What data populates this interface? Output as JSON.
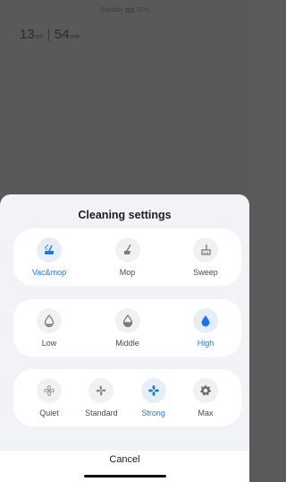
{
  "status": {
    "text": "Standby",
    "battery": "62%"
  },
  "stats": {
    "area_value": "13",
    "area_unit": "m²",
    "time_value": "54",
    "time_unit": "min"
  },
  "sheet": {
    "title": "Cleaning settings",
    "mode": {
      "options": [
        {
          "label": "Vac&mop",
          "icon": "vac-mop-icon",
          "active": true
        },
        {
          "label": "Mop",
          "icon": "mop-icon",
          "active": false
        },
        {
          "label": "Sweep",
          "icon": "broom-icon",
          "active": false
        }
      ]
    },
    "water": {
      "options": [
        {
          "label": "Low",
          "icon": "water-low-icon",
          "active": false
        },
        {
          "label": "Middle",
          "icon": "water-middle-icon",
          "active": false
        },
        {
          "label": "High",
          "icon": "water-high-icon",
          "active": true
        }
      ]
    },
    "suction": {
      "options": [
        {
          "label": "Quiet",
          "icon": "fan-quiet-icon",
          "active": false
        },
        {
          "label": "Standard",
          "icon": "fan-standard-icon",
          "active": false
        },
        {
          "label": "Strong",
          "icon": "fan-strong-icon",
          "active": true
        },
        {
          "label": "Max",
          "icon": "fan-max-icon",
          "active": false
        }
      ]
    },
    "cancel_label": "Cancel"
  },
  "colors": {
    "accent": "#1d78e6",
    "inactive_icon": "#7a7a7a",
    "sheet_bg": "#f2f3f6"
  }
}
